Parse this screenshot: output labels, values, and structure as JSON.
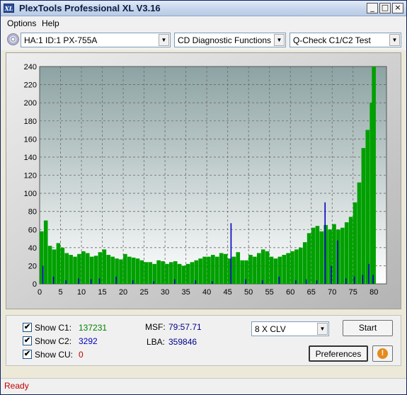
{
  "window": {
    "title": "PlexTools Professional XL V3.16",
    "icon_text": "XL",
    "minimize": "_",
    "maximize": "□",
    "close": "×"
  },
  "menu": {
    "options": "Options",
    "help": "Help"
  },
  "toolbar": {
    "drive": "HA:1 ID:1  PX-755A",
    "function": "CD Diagnostic Functions",
    "test": "Q-Check C1/C2 Test"
  },
  "chart_data": {
    "type": "bar",
    "title": "",
    "xlabel": "",
    "ylabel": "",
    "xlim": [
      0,
      83
    ],
    "ylim": [
      0,
      240
    ],
    "x_ticks": [
      0,
      5,
      10,
      15,
      20,
      25,
      30,
      35,
      40,
      45,
      50,
      55,
      60,
      65,
      70,
      75,
      80
    ],
    "y_ticks": [
      0,
      20,
      40,
      60,
      80,
      100,
      120,
      140,
      160,
      180,
      200,
      220,
      240
    ],
    "grid": true,
    "series": [
      {
        "color": "#00a000",
        "x": [
          0,
          1,
          2,
          3,
          4,
          5,
          6,
          7,
          8,
          9,
          10,
          11,
          12,
          13,
          14,
          15,
          16,
          17,
          18,
          19,
          20,
          21,
          22,
          23,
          24,
          25,
          26,
          27,
          28,
          29,
          30,
          31,
          32,
          33,
          34,
          35,
          36,
          37,
          38,
          39,
          40,
          41,
          42,
          43,
          44,
          45,
          46,
          47,
          48,
          49,
          50,
          51,
          52,
          53,
          54,
          55,
          56,
          57,
          58,
          59,
          60,
          61,
          62,
          63,
          64,
          65,
          66,
          67,
          68,
          69,
          70,
          71,
          72,
          73,
          74,
          75,
          76,
          77,
          78,
          79,
          79.5
        ],
        "values": [
          58,
          70,
          42,
          38,
          45,
          40,
          34,
          32,
          30,
          33,
          36,
          34,
          30,
          31,
          35,
          38,
          32,
          30,
          28,
          27,
          33,
          30,
          29,
          28,
          26,
          24,
          24,
          22,
          26,
          25,
          22,
          24,
          25,
          22,
          20,
          22,
          24,
          26,
          28,
          30,
          30,
          32,
          30,
          34,
          33,
          28,
          30,
          35,
          26,
          26,
          32,
          30,
          34,
          38,
          36,
          30,
          28,
          30,
          32,
          34,
          36,
          38,
          40,
          46,
          56,
          62,
          64,
          58,
          65,
          60,
          66,
          60,
          62,
          68,
          74,
          90,
          112,
          150,
          170,
          200,
          240
        ]
      },
      {
        "color": "#0000c0",
        "x": [
          0.5,
          3,
          6,
          9,
          12,
          14,
          18,
          22,
          27,
          32,
          37,
          41,
          45.5,
          49,
          53,
          57,
          61,
          63.5,
          66,
          68,
          69.5,
          71,
          73,
          75,
          77,
          78.5,
          79.5
        ],
        "values": [
          20,
          8,
          4,
          6,
          5,
          6,
          8,
          4,
          3,
          5,
          4,
          3,
          67,
          5,
          4,
          8,
          4,
          5,
          4,
          90,
          20,
          48,
          6,
          8,
          10,
          22,
          10
        ]
      }
    ]
  },
  "panel": {
    "show_c1": "Show C1:",
    "c1_value": "137231",
    "show_c2": "Show C2:",
    "c2_value": "3292",
    "show_cu": "Show CU:",
    "cu_value": "0",
    "msf_label": "MSF:",
    "msf_value": "79:57.71",
    "lba_label": "LBA:",
    "lba_value": "359846",
    "speed": "8 X CLV",
    "start": "Start",
    "preferences": "Preferences",
    "info_icon": "!",
    "check": "✔",
    "colors": {
      "c1": "#008000",
      "c2": "#0000c0",
      "cu": "#c00000",
      "value": "#00008b"
    }
  },
  "status": {
    "text": "Ready"
  }
}
